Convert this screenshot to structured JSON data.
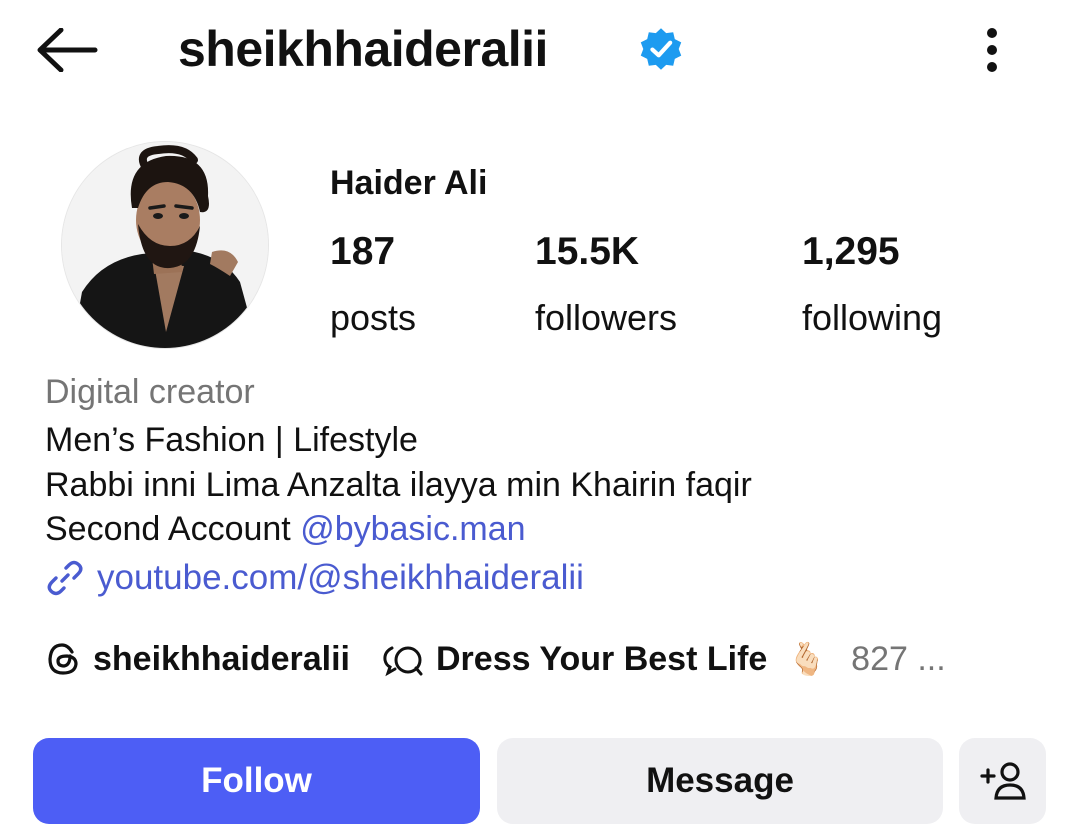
{
  "header": {
    "username": "sheikhhaideralii",
    "back_icon": "arrow-left-icon",
    "verified_icon": "verified-badge-icon",
    "more_icon": "more-vertical-icon"
  },
  "profile": {
    "display_name": "Haider Ali",
    "stats": [
      {
        "value": "187",
        "label": "posts"
      },
      {
        "value": "15.5K",
        "label": "followers"
      },
      {
        "value": "1,295",
        "label": "following"
      }
    ]
  },
  "bio": {
    "category": "Digital creator",
    "line1": "Men’s Fashion | Lifestyle",
    "line2": "Rabbi inni Lima Anzalta ilayya min Khairin faqir",
    "line3_prefix": "Second Account ",
    "line3_mention": "@bybasic.man",
    "link": "youtube.com/@sheikhhaideralii"
  },
  "chips": {
    "threads_handle": "sheikhhaideralii",
    "channel_name": "Dress Your Best Life",
    "channel_emoji": "🫰🏻",
    "channel_count": "827 ..."
  },
  "actions": {
    "follow": "Follow",
    "message": "Message"
  },
  "colors": {
    "accent": "#4d5ef5",
    "link": "#4a5bd0",
    "verified": "#1d9bf0",
    "secondary_text": "#757575",
    "button_gray": "#efeff2"
  }
}
